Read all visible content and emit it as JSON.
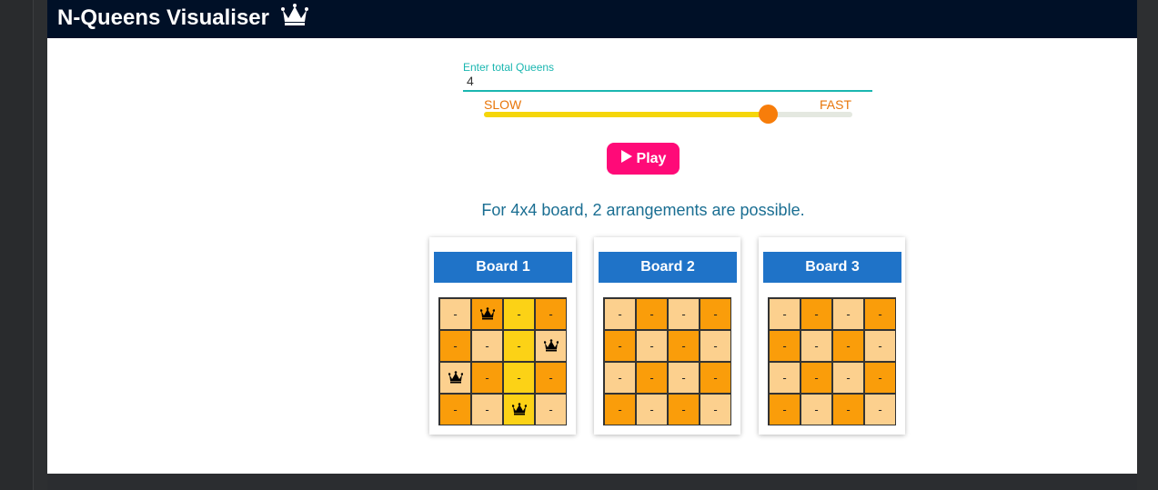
{
  "app": {
    "title": "N-Queens Visualiser"
  },
  "queens_input": {
    "label": "Enter total Queens",
    "value": "4"
  },
  "speed": {
    "slow_label": "SLOW",
    "fast_label": "FAST",
    "value_fraction": 0.77
  },
  "play_button": {
    "label": "Play",
    "icon": "play-icon",
    "color": "#ff0a78"
  },
  "info_text": "For 4x4 board, 2 arrangements are possible.",
  "colors": {
    "header": "#001027",
    "accent": "#1ab6b0",
    "card_title": "#1f73c8",
    "light_cell": "#fcd08e",
    "dark_cell": "#fa9d0a",
    "highlight_cell": "#fcd216",
    "slider_fill": "#f5d60a",
    "slider_thumb": "#f77d0a"
  },
  "boards": [
    {
      "title": "Board 1",
      "cells": [
        [
          "-",
          "Q",
          "-",
          "-"
        ],
        [
          "-",
          "-",
          "-",
          "Q"
        ],
        [
          "Q",
          "-",
          "-",
          "-"
        ],
        [
          "-",
          "-",
          "Q",
          "-"
        ]
      ],
      "highlight_column": 2
    },
    {
      "title": "Board 2",
      "cells": [
        [
          "-",
          "-",
          "-",
          "-"
        ],
        [
          "-",
          "-",
          "-",
          "-"
        ],
        [
          "-",
          "-",
          "-",
          "-"
        ],
        [
          "-",
          "-",
          "-",
          "-"
        ]
      ],
      "highlight_column": null
    },
    {
      "title": "Board 3",
      "cells": [
        [
          "-",
          "-",
          "-",
          "-"
        ],
        [
          "-",
          "-",
          "-",
          "-"
        ],
        [
          "-",
          "-",
          "-",
          "-"
        ],
        [
          "-",
          "-",
          "-",
          "-"
        ]
      ],
      "highlight_column": null
    }
  ]
}
